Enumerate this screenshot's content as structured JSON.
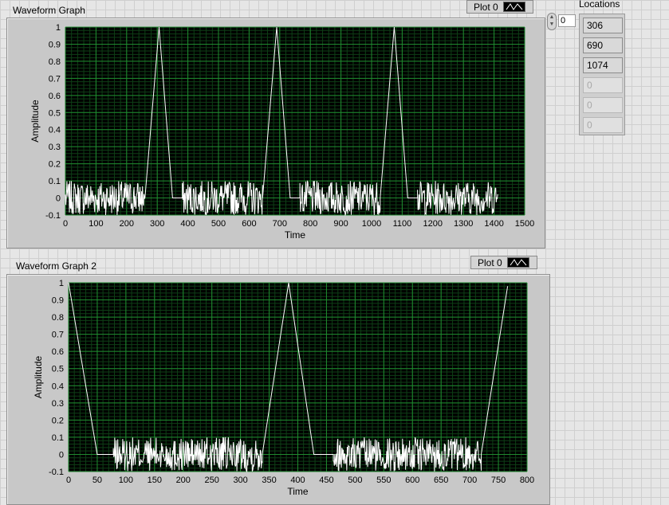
{
  "colors": {
    "plot_bg": "#000000",
    "grid_major": "#1f8a2f",
    "grid_minor": "#0e3f16",
    "trace": "#ffffff"
  },
  "graph1": {
    "title": "Waveform Graph",
    "legend_label": "Plot 0",
    "xlabel": "Time",
    "ylabel": "Amplitude",
    "x_ticks": [
      "0",
      "100",
      "200",
      "300",
      "400",
      "500",
      "600",
      "700",
      "800",
      "900",
      "1000",
      "1100",
      "1200",
      "1300",
      "1400",
      "1500"
    ],
    "y_ticks": [
      "1",
      "0.9",
      "0.8",
      "0.7",
      "0.6",
      "0.5",
      "0.4",
      "0.3",
      "0.2",
      "0.1",
      "0",
      "-0.1"
    ]
  },
  "graph2": {
    "title": "Waveform Graph 2",
    "legend_label": "Plot 0",
    "xlabel": "Time",
    "ylabel": "Amplitude",
    "x_ticks": [
      "0",
      "50",
      "100",
      "150",
      "200",
      "250",
      "300",
      "350",
      "400",
      "450",
      "500",
      "550",
      "600",
      "650",
      "700",
      "750",
      "800"
    ],
    "y_ticks": [
      "1",
      "0.9",
      "0.8",
      "0.7",
      "0.6",
      "0.5",
      "0.4",
      "0.3",
      "0.2",
      "0.1",
      "0",
      "-0.1"
    ]
  },
  "index": {
    "value": "0"
  },
  "locations": {
    "title": "Locations",
    "values": [
      "306",
      "690",
      "1074",
      "0",
      "0",
      "0"
    ]
  },
  "chart_data": [
    {
      "type": "line",
      "title": "Waveform Graph",
      "xlabel": "Time",
      "ylabel": "Amplitude",
      "xlim": [
        0,
        1500
      ],
      "ylim": [
        -0.1,
        1
      ],
      "grid": true,
      "series": [
        {
          "name": "Plot 0",
          "description_segments": [
            {
              "kind": "noise",
              "x": [
                0,
                260
              ],
              "y_range": [
                -0.1,
                0.1
              ]
            },
            {
              "kind": "line",
              "x": [
                260,
                306,
                350
              ],
              "y": [
                0,
                1,
                0
              ]
            },
            {
              "kind": "flat",
              "x": [
                350,
                382
              ],
              "y": 0
            },
            {
              "kind": "noise",
              "x": [
                382,
                644
              ],
              "y_range": [
                -0.1,
                0.1
              ]
            },
            {
              "kind": "line",
              "x": [
                644,
                690,
                734
              ],
              "y": [
                0,
                1,
                0
              ]
            },
            {
              "kind": "flat",
              "x": [
                734,
                766
              ],
              "y": 0
            },
            {
              "kind": "noise",
              "x": [
                766,
                1028
              ],
              "y_range": [
                -0.1,
                0.1
              ]
            },
            {
              "kind": "line",
              "x": [
                1028,
                1074,
                1118
              ],
              "y": [
                0,
                1,
                0
              ]
            },
            {
              "kind": "flat",
              "x": [
                1118,
                1150
              ],
              "y": 0
            },
            {
              "kind": "noise",
              "x": [
                1150,
                1412
              ],
              "y_range": [
                -0.1,
                0.1
              ]
            }
          ]
        }
      ]
    },
    {
      "type": "line",
      "title": "Waveform Graph 2",
      "xlabel": "Time",
      "ylabel": "Amplitude",
      "xlim": [
        0,
        800
      ],
      "ylim": [
        -0.1,
        1
      ],
      "grid": true,
      "series": [
        {
          "name": "Plot 0",
          "description_segments": [
            {
              "kind": "line",
              "x": [
                0,
                50
              ],
              "y": [
                1,
                0
              ]
            },
            {
              "kind": "flat",
              "x": [
                50,
                78
              ],
              "y": 0
            },
            {
              "kind": "noise",
              "x": [
                78,
                338
              ],
              "y_range": [
                -0.1,
                0.1
              ]
            },
            {
              "kind": "line",
              "x": [
                338,
                384,
                428
              ],
              "y": [
                0,
                1,
                0
              ]
            },
            {
              "kind": "flat",
              "x": [
                428,
                462
              ],
              "y": 0
            },
            {
              "kind": "noise",
              "x": [
                462,
                720
              ],
              "y_range": [
                -0.1,
                0.1
              ]
            },
            {
              "kind": "line",
              "x": [
                720,
                766
              ],
              "y": [
                0,
                0.98
              ]
            }
          ]
        }
      ]
    }
  ]
}
